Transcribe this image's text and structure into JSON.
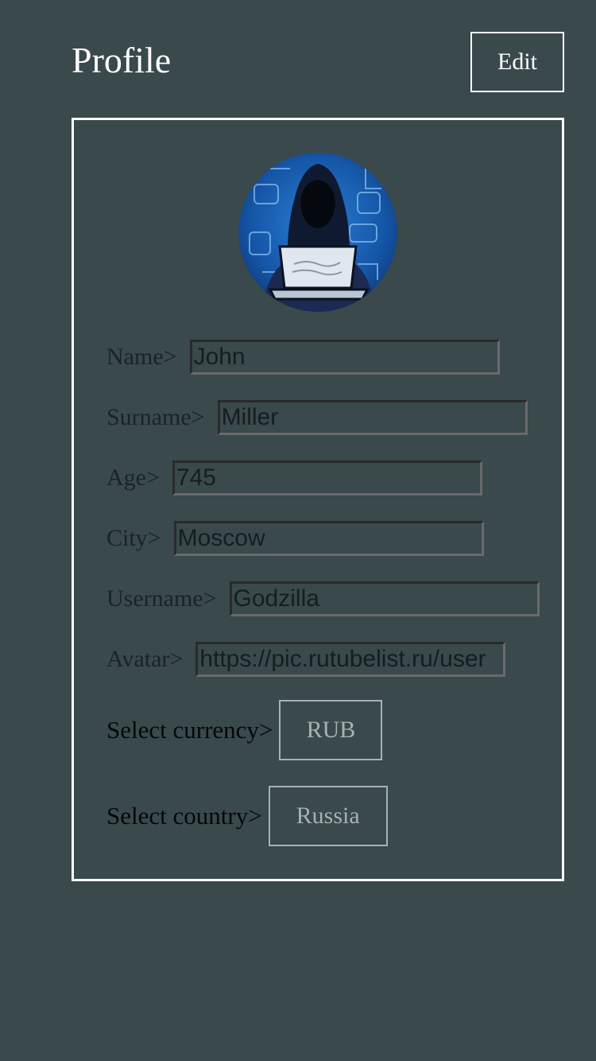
{
  "header": {
    "title": "Profile",
    "edit_label": "Edit"
  },
  "profile": {
    "avatar_alt": "hooded hacker avatar",
    "fields": [
      {
        "label": "Name>",
        "value": "John"
      },
      {
        "label": "Surname>",
        "value": "Miller"
      },
      {
        "label": "Age>",
        "value": "745"
      },
      {
        "label": "City>",
        "value": "Moscow"
      },
      {
        "label": "Username>",
        "value": "Godzilla"
      },
      {
        "label": "Avatar>",
        "value": "https://pic.rutubelist.ru/user"
      }
    ],
    "currency": {
      "label": "Select currency>",
      "value": "RUB"
    },
    "country": {
      "label": "Select country>",
      "value": "Russia"
    }
  },
  "colors": {
    "background": "#3a494b",
    "border": "#ffffff",
    "muted": "#a9b1b1"
  }
}
